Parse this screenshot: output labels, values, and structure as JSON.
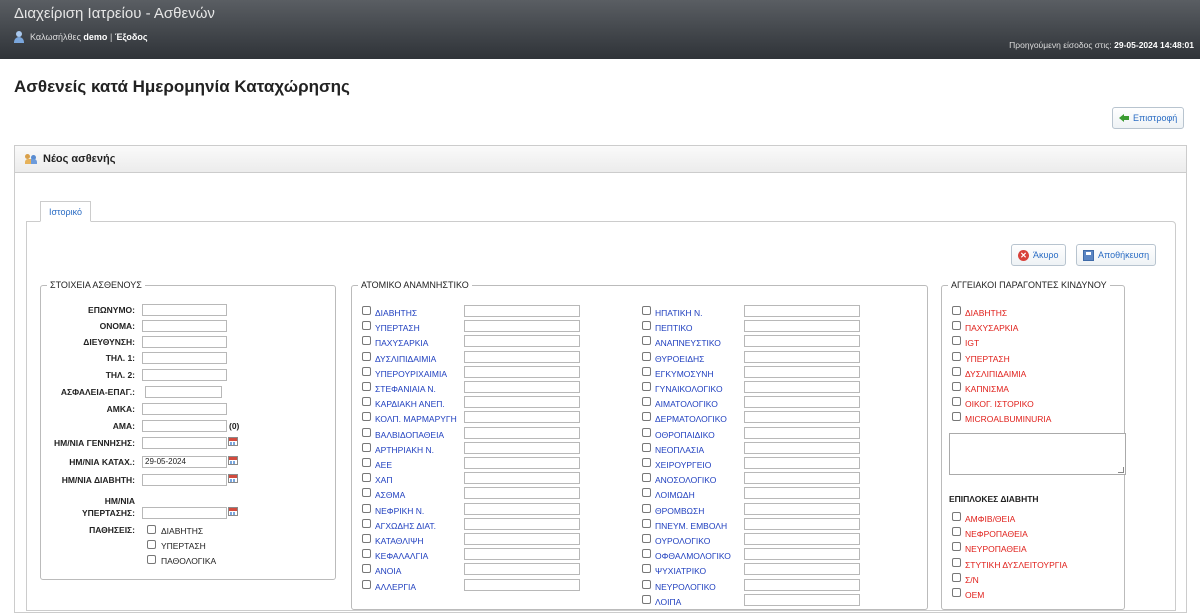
{
  "app": {
    "title": "Διαχείριση Ιατρείου - Ασθενών",
    "welcome_prefix": "Καλωσήλθες",
    "username": "demo",
    "separator": "|",
    "logout": "Έξοδος",
    "last_login_label": "Προηγούμενη είσοδος στις:",
    "last_login_value": "29-05-2024 14:48:01"
  },
  "page": {
    "title": "Ασθενείς κατά Ημερομηνία Καταχώρησης",
    "back_button": "Επιστροφή"
  },
  "panel": {
    "title": "Νέος ασθενής",
    "tab": "Ιστορικό",
    "cancel_button": "Άκυρο",
    "save_button": "Αποθήκευση"
  },
  "patient": {
    "legend": "ΣΤΟΙΧΕΙΑ ΑΣΘΕΝΟΥΣ",
    "fields": [
      {
        "label": "ΕΠΩΝΥΜΟ:",
        "value": ""
      },
      {
        "label": "ΟΝΟΜΑ:",
        "value": ""
      },
      {
        "label": "ΔΙΕΥΘΥΝΣΗ:",
        "value": ""
      },
      {
        "label": "ΤΗΛ. 1:",
        "value": ""
      },
      {
        "label": "ΤΗΛ. 2:",
        "value": ""
      },
      {
        "label": "ΑΣΦΑΛΕΙΑ-ΕΠΑΓ.:",
        "value": ""
      },
      {
        "label": "ΑΜΚΑ:",
        "value": ""
      },
      {
        "label": "ΑΜΑ:",
        "value": "",
        "suffix": "(0)"
      },
      {
        "label": "ΗΜ/ΝΙΑ ΓΕΝΝΗΣΗΣ:",
        "value": ""
      },
      {
        "label": "ΗΜ/ΝΙΑ ΚΑΤΑΧ.:",
        "value": "29-05-2024"
      },
      {
        "label": "ΗΜ/ΝΙΑ ΔΙΑΒΗΤΗ:",
        "value": ""
      },
      {
        "label_line1": "ΗΜ/ΝΙΑ",
        "label_line2": "ΥΠΕΡΤΑΣΗΣ:",
        "value": ""
      }
    ],
    "conditions_label": "ΠΑΘΗΣΕΙΣ:",
    "conditions": [
      "ΔΙΑΒΗΤΗΣ",
      "ΥΠΕΡΤΑΣΗ",
      "ΠΑΘΟΛΟΓΙΚΑ"
    ]
  },
  "history": {
    "legend": "ΑΤΟΜΙΚΟ ΑΝΑΜΝΗΣΤΙΚΟ",
    "col1": [
      "ΔΙΑΒΗΤΗΣ",
      "ΥΠΕΡΤΑΣΗ",
      "ΠΑΧΥΣΑΡΚΙΑ",
      "ΔΥΣΛΙΠΙΔΑΙΜΙΑ",
      "ΥΠΕΡΟΥΡΙΧΑΙΜΙΑ",
      "ΣΤΕΦΑΝΙΑΙΑ Ν.",
      "ΚΑΡΔΙΑΚΗ ΑΝΕΠ.",
      "ΚΟΛΠ. ΜΑΡΜΑΡΥΓΗ",
      "ΒΑΛΒΙΔΟΠΑΘΕΙΑ",
      "ΑΡΤΗΡΙΑΚΗ Ν.",
      "ΑΕΕ",
      "ΧΑΠ",
      "ΑΣΘΜΑ",
      "ΝΕΦΡΙΚΗ Ν.",
      "ΑΓΧΩΔΗΣ ΔΙΑΤ.",
      "ΚΑΤΑΘΛΙΨΗ",
      "ΚΕΦΑΛΑΛΓΙΑ",
      "ΑΝΟΙΑ",
      "ΑΛΛΕΡΓΙΑ"
    ],
    "col2": [
      "ΗΠΑΤΙΚΗ Ν.",
      "ΠΕΠΤΙΚΟ",
      "ΑΝΑΠΝΕΥΣΤΙΚΟ",
      "ΘΥΡΟΕΙΔΗΣ",
      "ΕΓΚΥΜΟΣΥΝΗ",
      "ΓΥΝΑΙΚΟΛΟΓΙΚΟ",
      "ΑΙΜΑΤΟΛΟΓΙΚΟ",
      "ΔΕΡΜΑΤΟΛΟΓΙΚΟ",
      "ΟΘΡΟΠΑΙΔΙΚΟ",
      "ΝΕΟΠΛΑΣΙΑ",
      "ΧΕΙΡΟΥΡΓΕΙΟ",
      "ΑΝΟΣΟΛΟΓΙΚΟ",
      "ΛΟΙΜΩΔΗ",
      "ΘΡΟΜΒΩΣΗ",
      "ΠΝΕΥΜ. ΕΜΒΟΛΗ",
      "ΟΥΡΟΛΟΓΙΚΟ",
      "ΟΦΘΑΛΜΟΛΟΓΙΚΟ",
      "ΨΥΧΙΑΤΡΙΚΟ",
      "ΝΕΥΡΟΛΟΓΙΚΟ",
      "ΛΟΙΠΑ"
    ]
  },
  "risk": {
    "legend": "ΑΓΓΕΙΑΚΟΙ ΠΑΡΑΓΟΝΤΕΣ ΚΙΝΔΥΝΟΥ",
    "items": [
      "ΔΙΑΒΗΤΗΣ",
      "ΠΑΧΥΣΑΡΚΙΑ",
      "IGT",
      "ΥΠΕΡΤΑΣΗ",
      "ΔΥΣΛΙΠΙΔΑΙΜΙΑ",
      "ΚΑΠΝΙΣΜΑ",
      "ΟΙΚΟΓ. ΙΣΤΟΡΙΚΟ",
      "MICROALBUMINURIA"
    ],
    "complications_title": "ΕΠΙΠΛΟΚΕΣ ΔΙΑΒΗΤΗ",
    "complications": [
      "ΑΜΦΙΒ/ΘΕΙΑ",
      "ΝΕΦΡΟΠΑΘΕΙΑ",
      "ΝΕΥΡΟΠΑΘΕΙΑ",
      "ΣΤΥΤΙΚΗ ΔΥΣΛΕΙΤΟΥΡΓΙΑ",
      "Σ/Ν",
      "ΟΕΜ"
    ]
  },
  "colors": {
    "link_blue": "#1f3fbf",
    "risk_red": "#e0201b",
    "header_dark": "#2f3338"
  }
}
